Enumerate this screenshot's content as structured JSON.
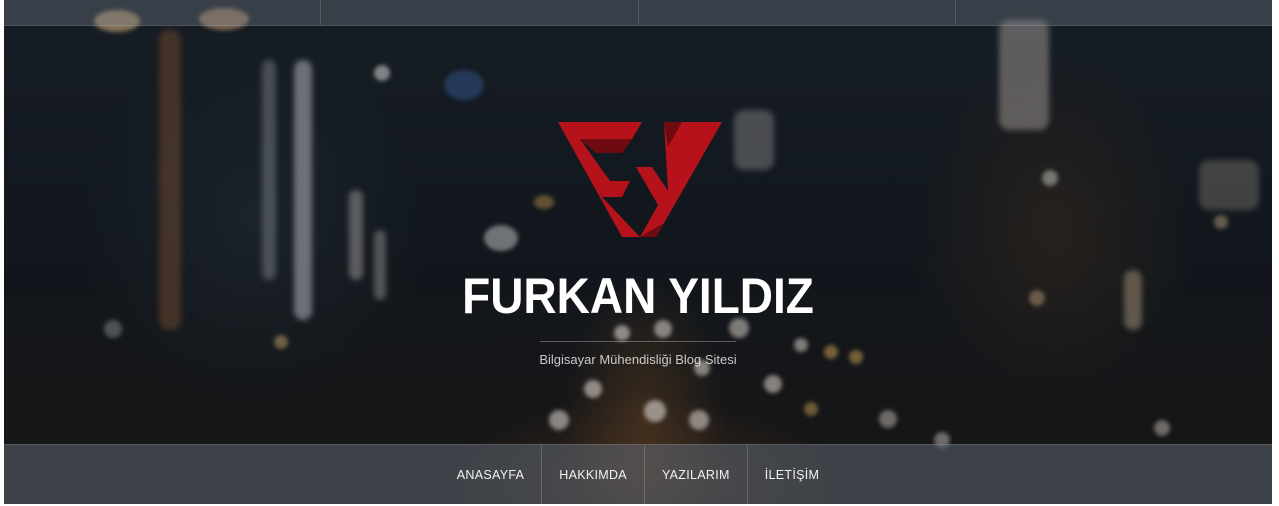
{
  "site": {
    "title": "FURKAN YILDIZ",
    "tagline": "Bilgisayar Mühendisliği Blog Sitesi",
    "logo_icon": "fy-monogram-logo",
    "colors": {
      "logo_red": "#b5121b",
      "logo_dark_red": "#6e0a10",
      "title_white": "#ffffff"
    }
  },
  "nav": {
    "items": [
      {
        "label": "ANASAYFA"
      },
      {
        "label": "HAKKIMDA"
      },
      {
        "label": "YAZILARIM"
      },
      {
        "label": "İLETİŞİM"
      }
    ]
  }
}
